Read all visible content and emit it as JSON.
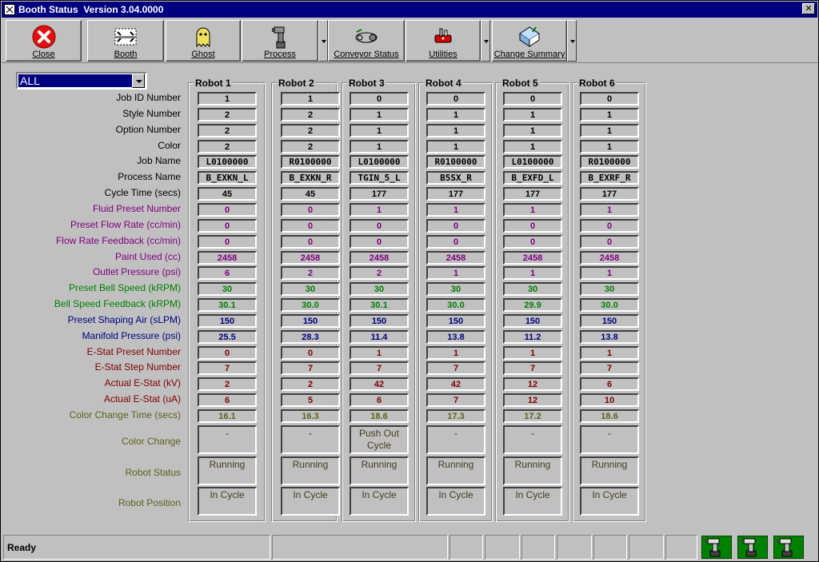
{
  "window": {
    "title": "Booth Status  Version 3.04.0000",
    "close_glyph": "✕"
  },
  "toolbar": {
    "buttons": [
      {
        "label": "Close",
        "icon": "close-icon"
      },
      {
        "label": "Booth",
        "icon": "booth-icon"
      },
      {
        "label": "Ghost",
        "icon": "ghost-icon"
      },
      {
        "label": "Process",
        "icon": "robot-arm-icon"
      },
      {
        "label": "Conveyor Status",
        "icon": "conveyor-icon"
      },
      {
        "label": "Utilities",
        "icon": "utilities-icon"
      },
      {
        "label": "Change Summary",
        "icon": "change-summary-icon"
      }
    ]
  },
  "filter": {
    "selected": "ALL"
  },
  "row_labels": [
    {
      "text": "Job ID Number",
      "color": "black"
    },
    {
      "text": "Style Number",
      "color": "black"
    },
    {
      "text": "Option Number",
      "color": "black"
    },
    {
      "text": "Color",
      "color": "black"
    },
    {
      "text": "Job Name",
      "color": "black"
    },
    {
      "text": "Process Name",
      "color": "black"
    },
    {
      "text": "Cycle Time (secs)",
      "color": "black"
    },
    {
      "text": "Fluid Preset Number",
      "color": "purple"
    },
    {
      "text": "Preset Flow Rate (cc/min)",
      "color": "purple"
    },
    {
      "text": "Flow Rate Feedback (cc/min)",
      "color": "purple"
    },
    {
      "text": "Paint Used (cc)",
      "color": "purple"
    },
    {
      "text": "Outlet Pressure (psi)",
      "color": "purple"
    },
    {
      "text": "Preset Bell Speed (kRPM)",
      "color": "green"
    },
    {
      "text": "Bell Speed Feedback (kRPM)",
      "color": "green"
    },
    {
      "text": "Preset Shaping Air (sLPM)",
      "color": "blue"
    },
    {
      "text": "Manifold Pressure (psi)",
      "color": "blue"
    },
    {
      "text": "E-Stat Preset Number",
      "color": "red"
    },
    {
      "text": "E-Stat Step Number",
      "color": "red"
    },
    {
      "text": "Actual E-Stat (kV)",
      "color": "red"
    },
    {
      "text": "Actual E-Stat (uA)",
      "color": "red"
    },
    {
      "text": "Color Change Time (secs)",
      "color": "olive"
    },
    {
      "text": "Color Change",
      "color": "olive"
    },
    {
      "text": "Robot Status",
      "color": "olive"
    },
    {
      "text": "Robot Position",
      "color": "olive"
    }
  ],
  "robots": [
    {
      "name": "Robot 1",
      "values": [
        "1",
        "2",
        "2",
        "2",
        "L0100000",
        "B_EXKN_L",
        "45",
        "0",
        "0",
        "0",
        "2458",
        "6",
        "30",
        "30.1",
        "150",
        "25.5",
        "0",
        "7",
        "2",
        "6",
        "16.1",
        "-",
        "Running",
        "In Cycle"
      ]
    },
    {
      "name": "Robot 2",
      "values": [
        "1",
        "2",
        "2",
        "2",
        "R0100000",
        "B_EXKN_R",
        "45",
        "0",
        "0",
        "0",
        "2458",
        "2",
        "30",
        "30.0",
        "150",
        "28.3",
        "0",
        "7",
        "2",
        "5",
        "16.3",
        "-",
        "Running",
        "In Cycle"
      ]
    },
    {
      "name": "Robot 3",
      "values": [
        "0",
        "1",
        "1",
        "1",
        "L0100000",
        "TGIN_5_L",
        "177",
        "1",
        "0",
        "0",
        "2458",
        "2",
        "30",
        "30.1",
        "150",
        "11.4",
        "1",
        "7",
        "42",
        "6",
        "18.6",
        "Push Out Cycle",
        "Running",
        "In Cycle"
      ]
    },
    {
      "name": "Robot 4",
      "values": [
        "0",
        "1",
        "1",
        "1",
        "R0100000",
        "B5SX_R",
        "177",
        "1",
        "0",
        "0",
        "2458",
        "1",
        "30",
        "30.0",
        "150",
        "13.8",
        "1",
        "7",
        "42",
        "7",
        "17.3",
        "-",
        "Running",
        "In Cycle"
      ]
    },
    {
      "name": "Robot 5",
      "values": [
        "0",
        "1",
        "1",
        "1",
        "L0100000",
        "B_EXFD_L",
        "177",
        "1",
        "0",
        "0",
        "2458",
        "1",
        "30",
        "29.9",
        "150",
        "11.2",
        "1",
        "7",
        "12",
        "12",
        "17.2",
        "-",
        "Running",
        "In Cycle"
      ]
    },
    {
      "name": "Robot 6",
      "values": [
        "0",
        "1",
        "1",
        "1",
        "R0100000",
        "B_EXRF_R",
        "177",
        "1",
        "0",
        "0",
        "2458",
        "1",
        "30",
        "30.0",
        "150",
        "13.8",
        "1",
        "7",
        "6",
        "10",
        "18.6",
        "-",
        "Running",
        "In Cycle"
      ]
    }
  ],
  "status": {
    "text": "Ready",
    "icons": [
      "robot-icon",
      "robot-icon",
      "robot-icon"
    ]
  },
  "colors": {
    "black": "#000000",
    "purple": "#800080",
    "green": "#008000",
    "blue": "#000080",
    "red": "#800000",
    "olive": "#606020",
    "title_bar": "#000080",
    "face": "#c0c0c0"
  }
}
